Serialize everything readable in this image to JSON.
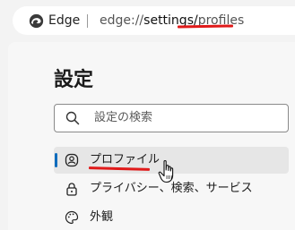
{
  "address_bar": {
    "browser_name": "Edge",
    "url_scheme": "edge://",
    "url_page": "settings",
    "url_slash": "/",
    "url_path": "profiles",
    "highlight_color": "#e01a1a"
  },
  "settings": {
    "title": "設定",
    "search_placeholder": "設定の検索",
    "nav_items": [
      {
        "label": "プロファイル",
        "icon": "profile-icon",
        "active": true
      },
      {
        "label": "プライバシー、検索、サービス",
        "icon": "lock-icon",
        "active": false
      },
      {
        "label": "外観",
        "icon": "palette-icon",
        "active": false
      }
    ],
    "accent_color": "#0f6cbd"
  }
}
